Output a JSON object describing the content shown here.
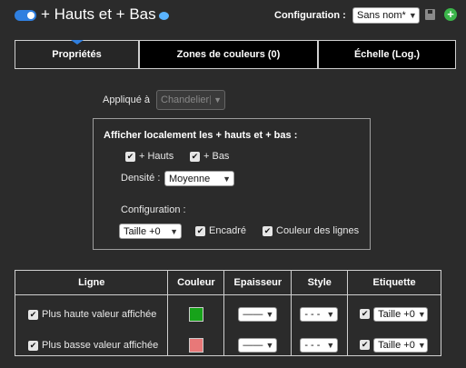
{
  "header": {
    "title": "+ Hauts et + Bas",
    "config_label": "Configuration :",
    "config_value": "Sans nom*"
  },
  "tabs": [
    {
      "label": "Propriétés",
      "active": true
    },
    {
      "label": "Zones de couleurs (0)",
      "active": false
    },
    {
      "label": "Échelle (Log.)",
      "active": false
    }
  ],
  "applique": {
    "label": "Appliqué à",
    "value": "Chandelier"
  },
  "local": {
    "title": "Afficher localement les + hauts et + bas :",
    "hauts_label": "+ Hauts",
    "hauts_checked": true,
    "bas_label": "+ Bas",
    "bas_checked": true,
    "densite_label": "Densité :",
    "densite_value": "Moyenne",
    "configuration_label": "Configuration :",
    "taille_value": "Taille +0",
    "encadre_label": "Encadré",
    "encadre_checked": true,
    "couleur_lignes_label": "Couleur des lignes",
    "couleur_lignes_checked": true
  },
  "table": {
    "headers": [
      "Ligne",
      "Couleur",
      "Epaisseur",
      "Style",
      "Etiquette"
    ],
    "rows": [
      {
        "label": "Plus haute valeur affichée",
        "checked": true,
        "color": "#17a31a",
        "epaisseur": "——",
        "style": "- - -",
        "etiquette_checked": true,
        "etiquette": "Taille +0"
      },
      {
        "label": "Plus basse valeur affichée",
        "checked": true,
        "color": "#e87878",
        "epaisseur": "——",
        "style": "- - -",
        "etiquette_checked": true,
        "etiquette": "Taille +0"
      }
    ]
  },
  "colors": {
    "accent": "#2f7fe0",
    "add": "#3bb54a",
    "background": "#2b2b2b"
  }
}
